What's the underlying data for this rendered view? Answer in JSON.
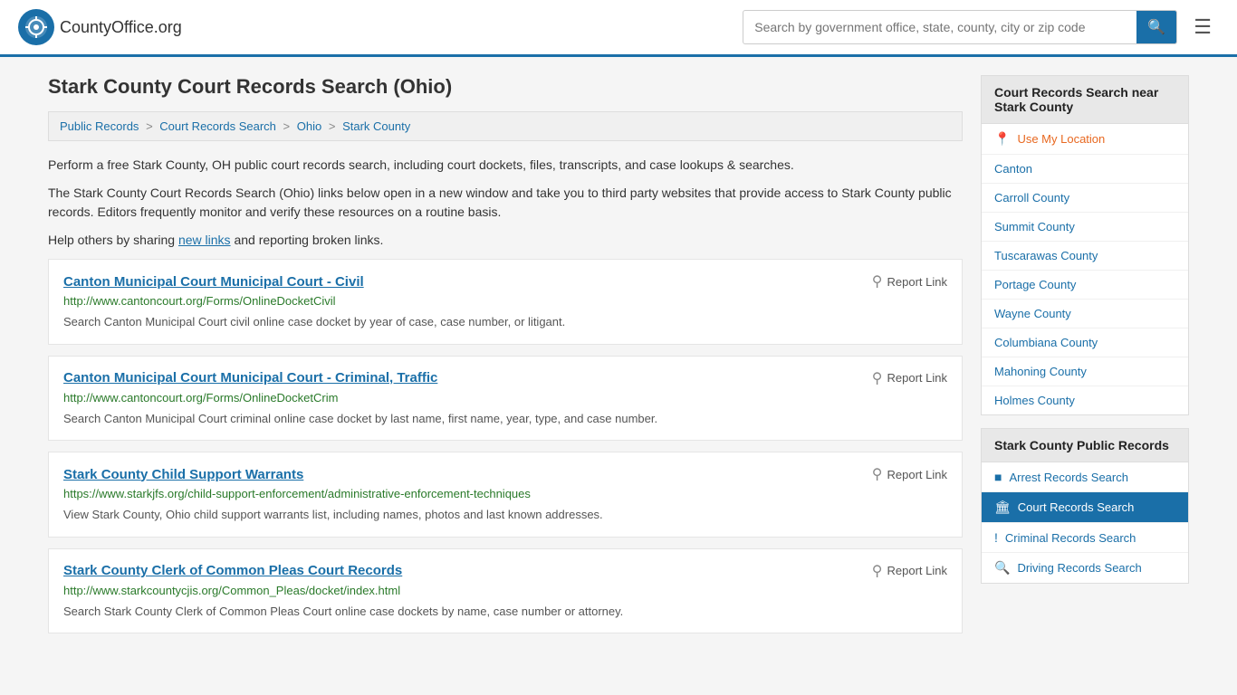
{
  "header": {
    "logo_text": "CountyOffice",
    "logo_suffix": ".org",
    "search_placeholder": "Search by government office, state, county, city or zip code",
    "search_value": ""
  },
  "page": {
    "title": "Stark County Court Records Search (Ohio)",
    "breadcrumbs": [
      {
        "label": "Public Records",
        "href": "#"
      },
      {
        "label": "Court Records Search",
        "href": "#"
      },
      {
        "label": "Ohio",
        "href": "#"
      },
      {
        "label": "Stark County",
        "href": "#"
      }
    ],
    "description1": "Perform a free Stark County, OH public court records search, including court dockets, files, transcripts, and case lookups & searches.",
    "description2": "The Stark County Court Records Search (Ohio) links below open in a new window and take you to third party websites that provide access to Stark County public records. Editors frequently monitor and verify these resources on a routine basis.",
    "description3_pre": "Help others by sharing ",
    "description3_link": "new links",
    "description3_post": " and reporting broken links."
  },
  "results": [
    {
      "title": "Canton Municipal Court Municipal Court - Civil",
      "url": "http://www.cantoncourt.org/Forms/OnlineDocketCivil",
      "desc": "Search Canton Municipal Court civil online case docket by year of case, case number, or litigant."
    },
    {
      "title": "Canton Municipal Court Municipal Court - Criminal, Traffic",
      "url": "http://www.cantoncourt.org/Forms/OnlineDocketCrim",
      "desc": "Search Canton Municipal Court criminal online case docket by last name, first name, year, type, and case number."
    },
    {
      "title": "Stark County Child Support Warrants",
      "url": "https://www.starkjfs.org/child-support-enforcement/administrative-enforcement-techniques",
      "desc": "View Stark County, Ohio child support warrants list, including names, photos and last known addresses."
    },
    {
      "title": "Stark County Clerk of Common Pleas Court Records",
      "url": "http://www.starkcountycjis.org/Common_Pleas/docket/index.html",
      "desc": "Search Stark County Clerk of Common Pleas Court online case dockets by name, case number or attorney."
    }
  ],
  "report_label": "Report Link",
  "sidebar": {
    "nearby_title": "Court Records Search near Stark County",
    "nearby_items": [
      {
        "label": "Use My Location",
        "icon": "📍",
        "type": "location"
      },
      {
        "label": "Canton",
        "icon": "",
        "type": "link"
      },
      {
        "label": "Carroll County",
        "icon": "",
        "type": "link"
      },
      {
        "label": "Summit County",
        "icon": "",
        "type": "link"
      },
      {
        "label": "Tuscarawas County",
        "icon": "",
        "type": "link"
      },
      {
        "label": "Portage County",
        "icon": "",
        "type": "link"
      },
      {
        "label": "Wayne County",
        "icon": "",
        "type": "link"
      },
      {
        "label": "Columbiana County",
        "icon": "",
        "type": "link"
      },
      {
        "label": "Mahoning County",
        "icon": "",
        "type": "link"
      },
      {
        "label": "Holmes County",
        "icon": "",
        "type": "link"
      }
    ],
    "public_records_title": "Stark County Public Records",
    "public_records_items": [
      {
        "label": "Arrest Records Search",
        "icon": "■",
        "active": false
      },
      {
        "label": "Court Records Search",
        "icon": "🏛",
        "active": true
      },
      {
        "label": "Criminal Records Search",
        "icon": "!",
        "active": false
      },
      {
        "label": "Driving Records Search",
        "icon": "🔍",
        "active": false
      }
    ]
  }
}
